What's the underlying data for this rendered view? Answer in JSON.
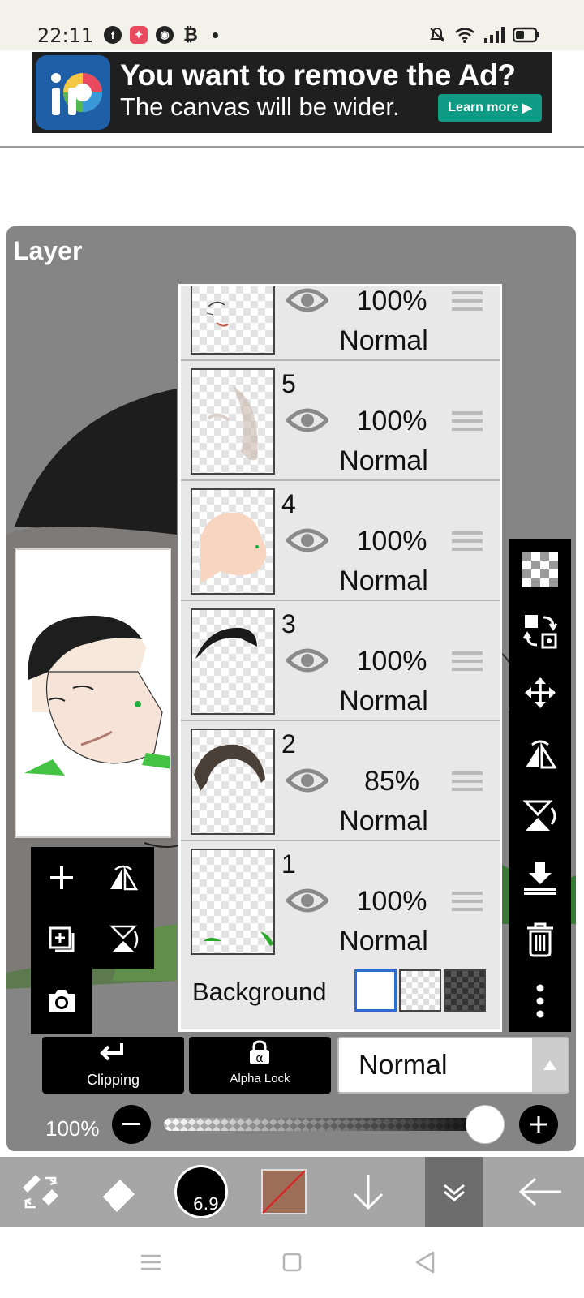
{
  "status_bar": {
    "time": "22:11",
    "left_icons": [
      "facebook-icon",
      "messenger-icon",
      "chrome-icon",
      "bitcoin-icon",
      "dot-icon"
    ],
    "right_icons": [
      "bell-muted-icon",
      "wifi-icon",
      "signal-icon",
      "battery-icon"
    ]
  },
  "ad": {
    "title": "You want to remove the Ad?",
    "subtitle": "The canvas will be wider.",
    "button": "Learn more"
  },
  "panel": {
    "title": "Layer"
  },
  "layers": [
    {
      "number": "",
      "opacity": "100%",
      "mode": "Normal",
      "thumb": "face-lines"
    },
    {
      "number": "5",
      "opacity": "100%",
      "mode": "Normal",
      "thumb": "shading"
    },
    {
      "number": "4",
      "opacity": "100%",
      "mode": "Normal",
      "thumb": "skin"
    },
    {
      "number": "3",
      "opacity": "100%",
      "mode": "Normal",
      "thumb": "hair-dark"
    },
    {
      "number": "2",
      "opacity": "85%",
      "mode": "Normal",
      "thumb": "hair-brown"
    },
    {
      "number": "1",
      "opacity": "100%",
      "mode": "Normal",
      "thumb": "green-bits"
    }
  ],
  "background": {
    "label": "Background"
  },
  "controls": {
    "clipping_label": "Clipping",
    "alpha_lock_label": "Alpha Lock",
    "blend_mode": "Normal",
    "opacity_label": "100%",
    "opacity_value": 1.0
  },
  "brush": {
    "size": "6.9"
  },
  "colors": {
    "accent_blue": "#2a6fd0",
    "ad_button": "#0e9a84",
    "current_color": "#9c6e58"
  }
}
